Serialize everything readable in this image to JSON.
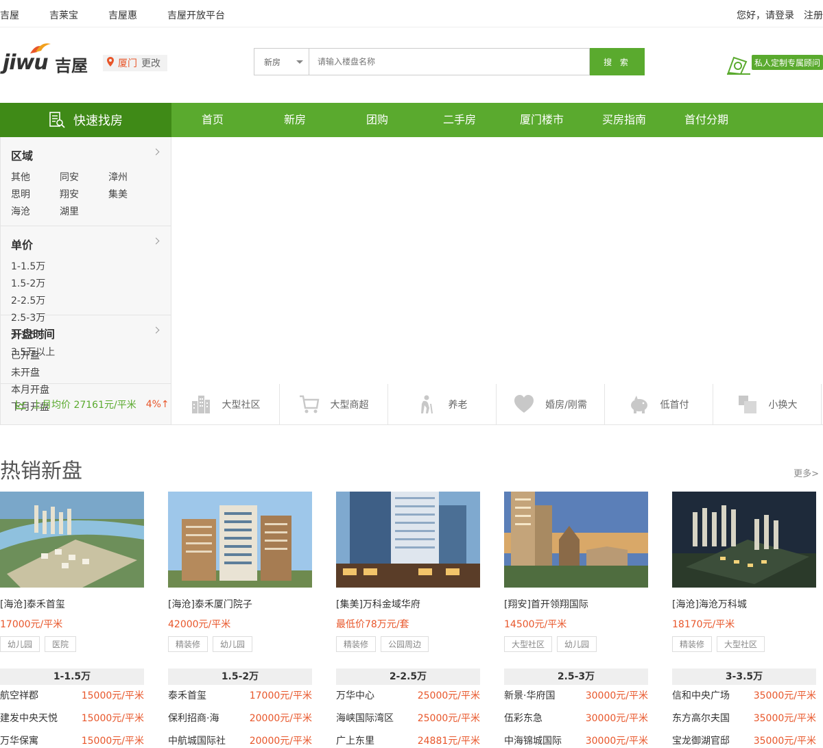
{
  "topbar": {
    "links": [
      "吉屋",
      "吉莱宝",
      "吉屋惠",
      "吉屋开放平台"
    ],
    "greeting": "您好，请登录",
    "register": "注册"
  },
  "header": {
    "logo_latin": "jiwu",
    "logo_cn": "吉屋",
    "city": "厦门",
    "city_change": "更改",
    "search": {
      "category": "新房",
      "placeholder": "请输入楼盘名称",
      "button": "搜 索"
    },
    "consultant": "私人定制专属顾问"
  },
  "nav": {
    "quick_find": "快速找房",
    "items": [
      "首页",
      "新房",
      "团购",
      "二手房",
      "厦门楼市",
      "买房指南",
      "首付分期"
    ]
  },
  "filter": {
    "region": {
      "title": "区域",
      "options": [
        "其他",
        "同安",
        "漳州",
        "思明",
        "翔安",
        "集美",
        "海沧",
        "湖里"
      ]
    },
    "unit_price": {
      "title": "单价",
      "options": [
        "1-1.5万",
        "1.5-2万",
        "2-2.5万",
        "2.5-3万",
        "3-3.5万",
        "3.5万以上"
      ]
    },
    "opening": {
      "title": "开盘时间",
      "options": [
        "已开盘",
        "未开盘",
        "本月开盘",
        "下月开盘"
      ]
    },
    "avg_price": "上月均价 27161元/平米",
    "avg_change": "4%↑"
  },
  "tags": [
    {
      "label": "大型社区",
      "icon": "buildings-icon"
    },
    {
      "label": "大型商超",
      "icon": "cart-icon"
    },
    {
      "label": "养老",
      "icon": "elderly-icon"
    },
    {
      "label": "婚房/刚需",
      "icon": "heart-icon"
    },
    {
      "label": "低首付",
      "icon": "piggy-bank-icon"
    },
    {
      "label": "小换大",
      "icon": "squares-icon"
    }
  ],
  "hot": {
    "title": "热销新盘",
    "more": "更多>",
    "cards": [
      {
        "name": "[海沧]泰禾首玺",
        "price": "17000元/平米",
        "features": [
          "幼儿园",
          "医院"
        ],
        "band": "1-1.5万",
        "rows": [
          {
            "n": "航空祥郡",
            "p": "15000元/平米"
          },
          {
            "n": "建发中央天悦",
            "p": "15000元/平米"
          },
          {
            "n": "万华保寓",
            "p": "15000元/平米"
          }
        ]
      },
      {
        "name": "[海沧]泰禾厦门院子",
        "price": "42000元/平米",
        "features": [
          "精装修",
          "幼儿园"
        ],
        "band": "1.5-2万",
        "rows": [
          {
            "n": "泰禾首玺",
            "p": "17000元/平米"
          },
          {
            "n": "保利招商·海",
            "p": "20000元/平米"
          },
          {
            "n": "中航城国际社",
            "p": "20000元/平米"
          }
        ]
      },
      {
        "name": "[集美]万科金域华府",
        "price": "最低价78万元/套",
        "features": [
          "精装修",
          "公园周边"
        ],
        "band": "2-2.5万",
        "rows": [
          {
            "n": "万华中心",
            "p": "25000元/平米"
          },
          {
            "n": "海峡国际湾区",
            "p": "25000元/平米"
          },
          {
            "n": "广上东里",
            "p": "24881元/平米"
          }
        ]
      },
      {
        "name": "[翔安]首开领翔国际",
        "price": "14500元/平米",
        "features": [
          "大型社区",
          "幼儿园"
        ],
        "band": "2.5-3万",
        "rows": [
          {
            "n": "新景·华府国",
            "p": "30000元/平米"
          },
          {
            "n": "伍彩东急",
            "p": "30000元/平米"
          },
          {
            "n": "中海锦城国际",
            "p": "30000元/平米"
          }
        ]
      },
      {
        "name": "[海沧]海沧万科城",
        "price": "18170元/平米",
        "features": [
          "精装修",
          "大型社区"
        ],
        "band": "3-3.5万",
        "rows": [
          {
            "n": "信和中央广场",
            "p": "35000元/平米"
          },
          {
            "n": "东方高尔夫国",
            "p": "35000元/平米"
          },
          {
            "n": "宝龙御湖官邸",
            "p": "35000元/平米"
          }
        ]
      }
    ]
  }
}
